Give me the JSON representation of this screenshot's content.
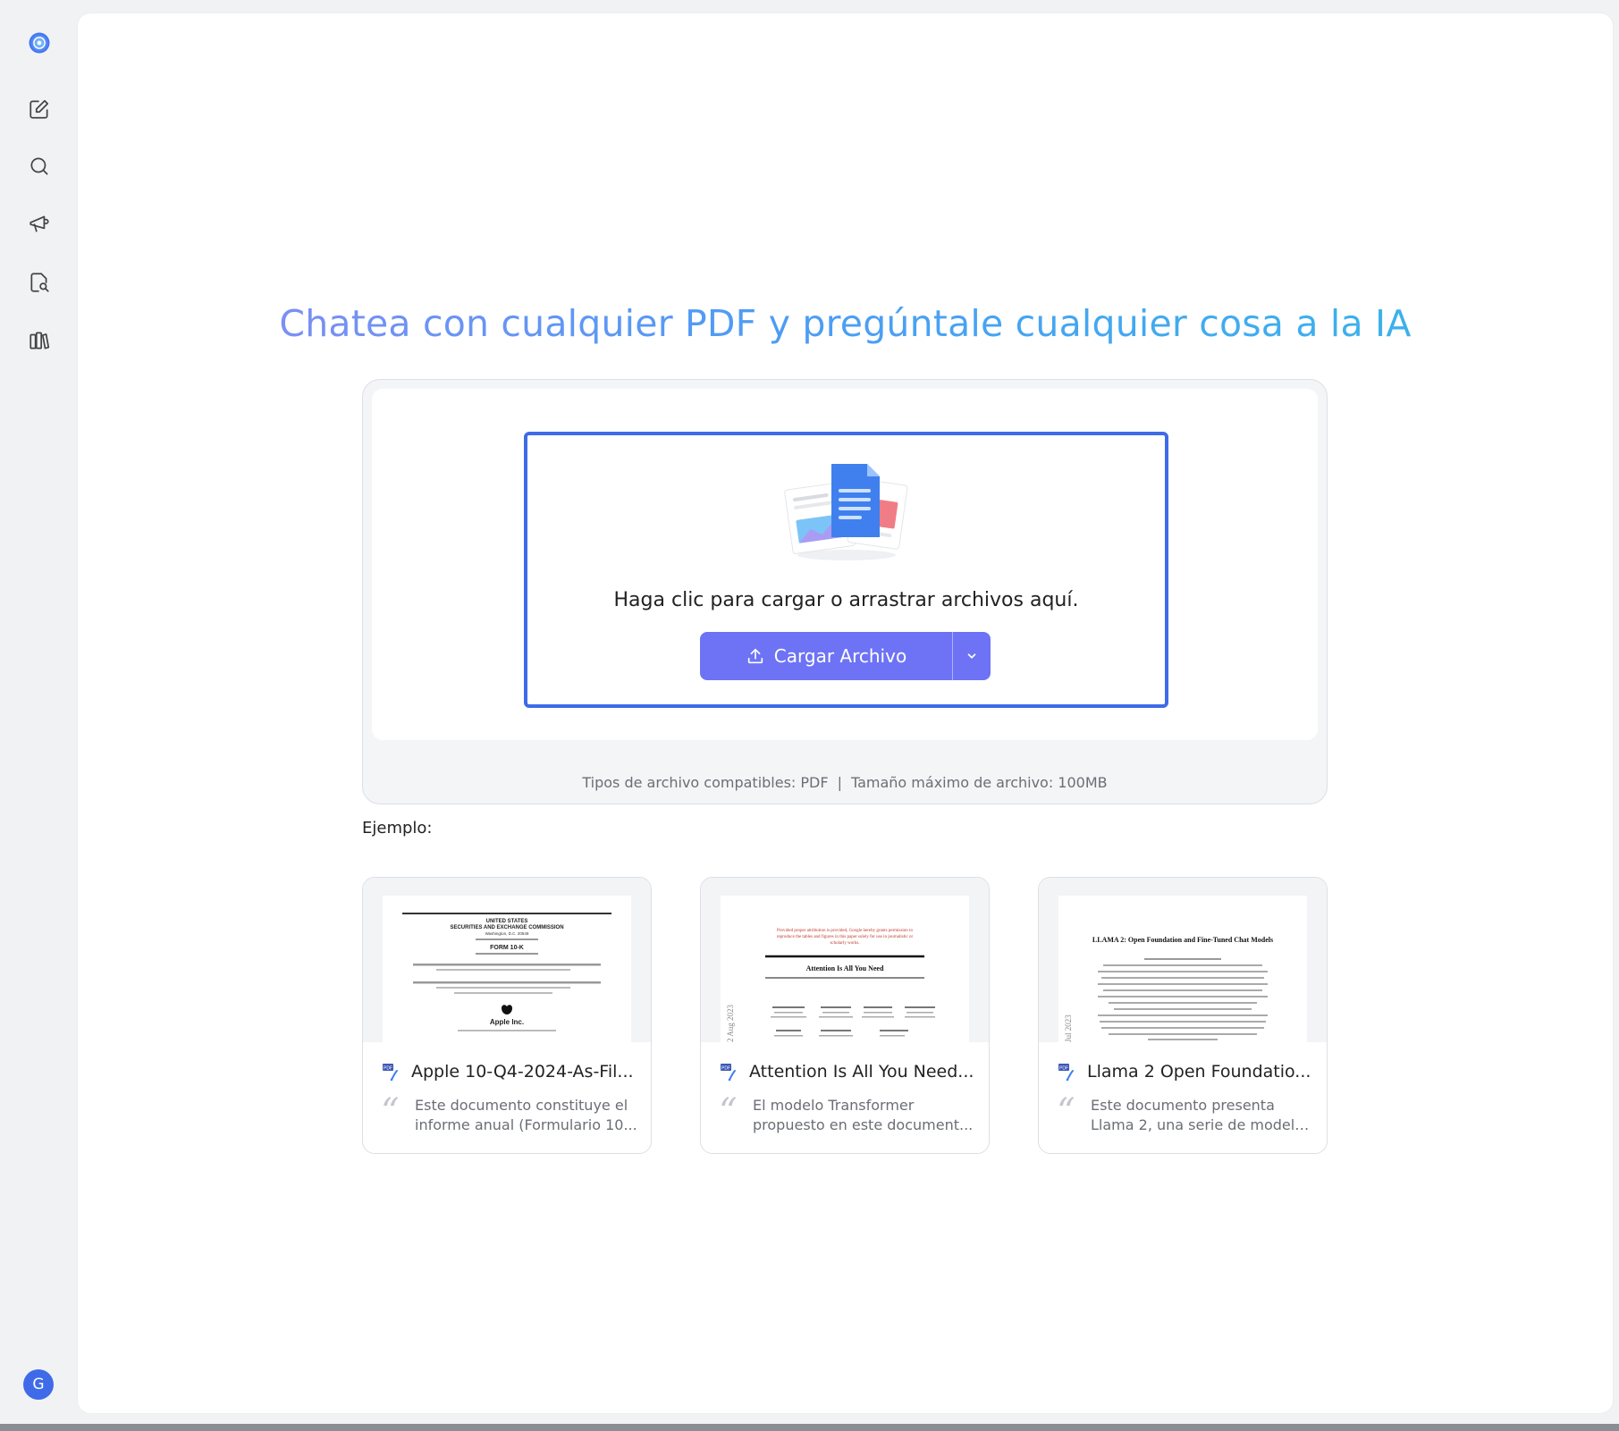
{
  "sidebar": {
    "items": [
      {
        "name": "logo",
        "icon": "app-logo-icon"
      },
      {
        "name": "new-chat",
        "icon": "edit-icon"
      },
      {
        "name": "search",
        "icon": "search-icon"
      },
      {
        "name": "announce",
        "icon": "megaphone-icon"
      },
      {
        "name": "document-search",
        "icon": "document-search-icon"
      },
      {
        "name": "library",
        "icon": "library-icon"
      }
    ],
    "avatar_initial": "G"
  },
  "headline": "Chatea con cualquier PDF y pregúntale cualquier cosa a la IA",
  "upload": {
    "prompt": "Haga clic para cargar o arrastrar archivos aquí.",
    "button_label": "Cargar Archivo",
    "types_label": "Tipos de archivo compatibles: PDF",
    "separator": "|",
    "max_size_label": "Tamaño máximo de archivo: 100MB"
  },
  "examples": {
    "label": "Ejemplo:",
    "cards": [
      {
        "title": "Apple 10-Q4-2024-As-Fil...",
        "desc_line1": "Este documento constituye el",
        "desc_line2": "informe anual (Formulario 10...",
        "thumb": {
          "l1": "UNITED STATES",
          "l2": "SECURITIES AND EXCHANGE COMMISSION",
          "l3": "Washington, D.C. 20549",
          "l4": "FORM 10-K",
          "l5": "Apple Inc."
        }
      },
      {
        "title": "Attention Is All You Need...",
        "desc_line1": "El modelo Transformer",
        "desc_line2": "propuesto en este document...",
        "thumb": {
          "l1": "Provided proper attribution is provided, Google hereby grants permission to",
          "l2": "reproduce the tables and figures in this paper solely for use in journalistic or",
          "l3": "scholarly works.",
          "l4": "Attention Is All You Need",
          "side": "2 Aug 2023"
        }
      },
      {
        "title": "Llama 2 Open Foundatio...",
        "desc_line1": "Este documento presenta",
        "desc_line2": "Llama 2, una serie de modelo...",
        "thumb": {
          "l1": "LLAMA 2: Open Foundation and Fine-Tuned Chat Models",
          "side": "Jul 2023"
        }
      }
    ]
  },
  "colors": {
    "accent": "#6d73f4",
    "dropzone_border": "#3f6be8",
    "headline_start": "#8d8af2",
    "headline_end": "#37b8e8"
  }
}
